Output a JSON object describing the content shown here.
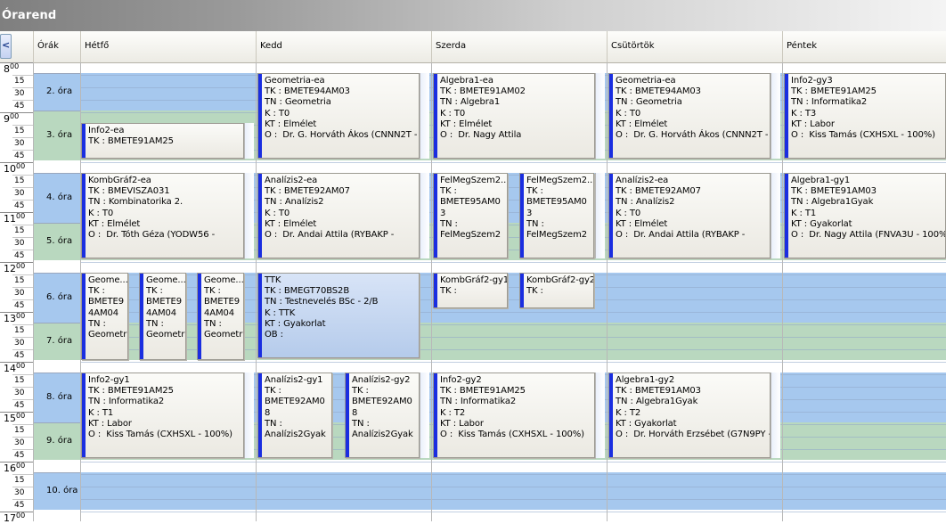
{
  "window": {
    "title": "Órarend"
  },
  "nav": {
    "prev": "<"
  },
  "header": {
    "ora_col": "Órák",
    "days": [
      "Hétfő",
      "Kedd",
      "Szerda",
      "Csütörtök",
      "Péntek"
    ]
  },
  "hours": [
    "8",
    "9",
    "10",
    "11",
    "12",
    "13",
    "14",
    "15",
    "16",
    "17"
  ],
  "hour_sup": "00",
  "minutes": [
    "15",
    "30",
    "45"
  ],
  "lessons": [
    "2. óra",
    "3. óra",
    "4. óra",
    "5. óra",
    "6. óra",
    "7. óra",
    "8. óra",
    "9. óra",
    "10. óra"
  ],
  "colors": {
    "blue": "#a6c8ee",
    "green": "#b9d8bf",
    "bar": "#1a2ee0"
  },
  "events": [
    {
      "day": "Kedd",
      "text": "Geometria-ea\nTK : BMETE94AM03\nTN : Geometria\nK : T0\nKT : Elmélet\nO :  Dr. G. Horváth Ákos (CNNN2T -"
    },
    {
      "day": "Szerda",
      "text": "Algebra1-ea\nTK : BMETE91AM02\nTN : Algebra1\nK : T0\nKT : Elmélet\nO :  Dr. Nagy Attila"
    },
    {
      "day": "Csütörtök",
      "text": "Geometria-ea\nTK : BMETE94AM03\nTN : Geometria\nK : T0\nKT : Elmélet\nO :  Dr. G. Horváth Ákos (CNNN2T -"
    },
    {
      "day": "Péntek",
      "text": "Info2-gy3\nTK : BMETE91AM25\nTN : Informatika2\nK : T3\nKT : Labor\nO :  Kiss Tamás (CXHSXL - 100%)"
    },
    {
      "day": "Hétfő",
      "text": "Info2-ea\nTK : BMETE91AM25"
    },
    {
      "day": "Hétfő",
      "text": "KombGráf2-ea\nTK : BMEVISZA031\nTN : Kombinatorika 2.\nK : T0\nKT : Elmélet\nO :  Dr. Tóth Géza (YODW56 -"
    },
    {
      "day": "Kedd",
      "text": "Analízis2-ea\nTK : BMETE92AM07\nTN : Analízis2\nK : T0\nKT : Elmélet\nO :  Dr. Andai Attila (RYBAKP -"
    },
    {
      "day": "Szerda",
      "text": "FelMegSzem2...\nTK :\nBMETE95AM0\n3\nTN :\nFelMegSzem2"
    },
    {
      "day": "Szerda",
      "text": "FelMegSzem2...\nTK :\nBMETE95AM0\n3\nTN :\nFelMegSzem2"
    },
    {
      "day": "Csütörtök",
      "text": "Analízis2-ea\nTK : BMETE92AM07\nTN : Analízis2\nK : T0\nKT : Elmélet\nO :  Dr. Andai Attila (RYBAKP -"
    },
    {
      "day": "Péntek",
      "text": "Algebra1-gy1\nTK : BMETE91AM03\nTN : Algebra1Gyak\nK : T1\nKT : Gyakorlat\nO :  Dr. Nagy Attila (FNVA3U - 100%)"
    },
    {
      "day": "Hétfő",
      "text": "Geome...\nTK :\nBMETE9\n4AM04\nTN :\nGeometri"
    },
    {
      "day": "Hétfő",
      "text": "Geome...\nTK :\nBMETE9\n4AM04\nTN :\nGeometri"
    },
    {
      "day": "Hétfő",
      "text": "Geome...\nTK :\nBMETE9\n4AM04\nTN :\nGeometri"
    },
    {
      "day": "Kedd",
      "text": "TTK\nTK : BMEGT70BS2B\nTN : Testnevelés BSc - 2/B\nK : TTK\nKT : Gyakorlat\nOB :"
    },
    {
      "day": "Szerda",
      "text": "KombGráf2-gy1\nTK :"
    },
    {
      "day": "Szerda",
      "text": "KombGráf2-gy2\nTK :"
    },
    {
      "day": "Hétfő",
      "text": "Info2-gy1\nTK : BMETE91AM25\nTN : Informatika2\nK : T1\nKT : Labor\nO :  Kiss Tamás (CXHSXL - 100%)"
    },
    {
      "day": "Kedd",
      "text": "Analízis2-gy1\nTK :\nBMETE92AM0\n8\nTN :\nAnalízis2Gyak"
    },
    {
      "day": "Kedd",
      "text": "Analízis2-gy2\nTK :\nBMETE92AM0\n8\nTN :\nAnalízis2Gyak"
    },
    {
      "day": "Szerda",
      "text": "Info2-gy2\nTK : BMETE91AM25\nTN : Informatika2\nK : T2\nKT : Labor\nO :  Kiss Tamás (CXHSXL - 100%)"
    },
    {
      "day": "Csütörtök",
      "text": "Algebra1-gy2\nTK : BMETE91AM03\nTN : Algebra1Gyak\nK : T2\nKT : Gyakorlat\nO :  Dr. Horváth Erzsébet (G7N9PY -"
    }
  ]
}
